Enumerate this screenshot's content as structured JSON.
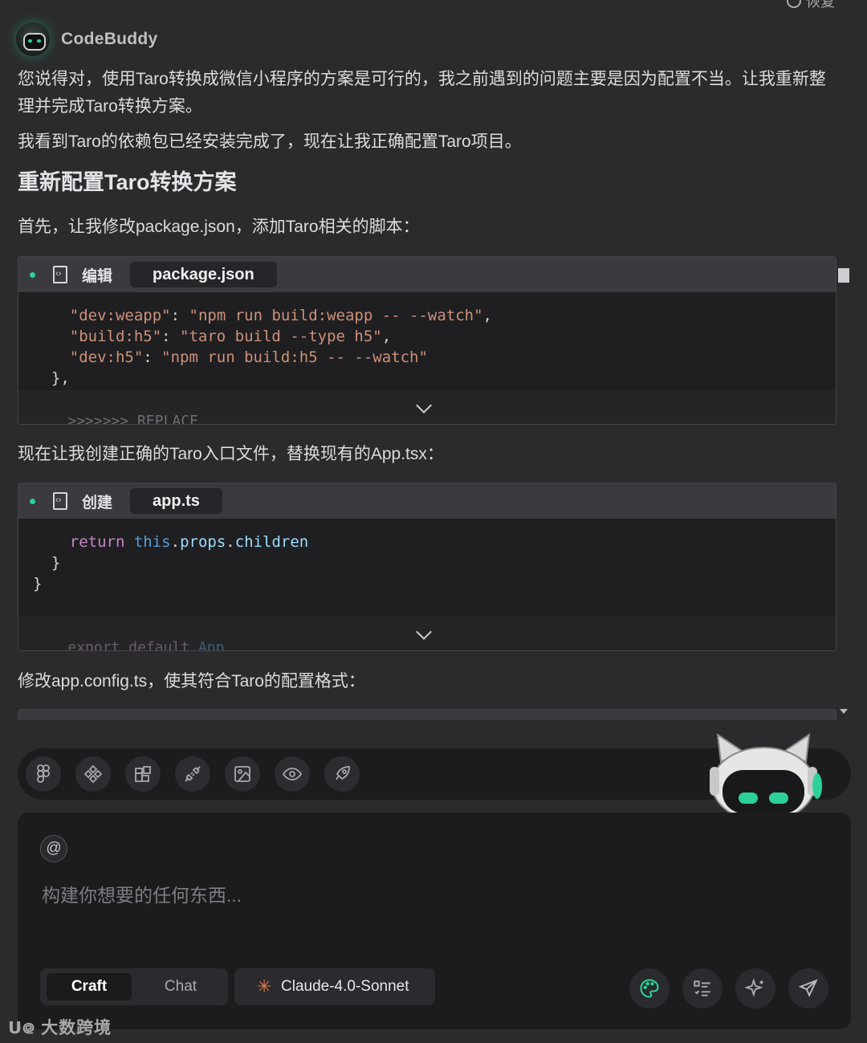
{
  "top_action": "恢复",
  "agent": {
    "name": "CodeBuddy"
  },
  "message": {
    "para1": "您说得对，使用Taro转换成微信小程序的方案是可行的，我之前遇到的问题主要是因为配置不当。让我重新整理并完成Taro转换方案。",
    "para2": "我看到Taro的依赖包已经安装完成了，现在让我正确配置Taro项目。",
    "heading": "重新配置Taro转换方案",
    "para3": "首先，让我修改package.json，添加Taro相关的脚本：",
    "para4": "现在让我创建正确的Taro入口文件，替换现有的App.tsx：",
    "para5": "修改app.config.ts，使其符合Taro的配置格式："
  },
  "cards": [
    {
      "action": "编辑",
      "file": "package.json",
      "lines": [
        {
          "key": "\"dev:weapp\"",
          "val": "\"npm run build:weapp -- --watch\"",
          "trail": ","
        },
        {
          "key": "\"build:h5\"",
          "val": "\"taro build --type h5\"",
          "trail": ","
        },
        {
          "key": "\"dev:h5\"",
          "val": "\"npm run build:h5 -- --watch\"",
          "trail": ""
        }
      ],
      "close": "},",
      "footer": ">>>>>>> REPLACE"
    },
    {
      "action": "创建",
      "file": "app.ts",
      "code_return": "return",
      "code_this": "this",
      "code_props": "props",
      "code_children": "children",
      "brace1": "}",
      "brace2": "}",
      "footer_export": "export",
      "footer_default": "default",
      "footer_app": "App"
    }
  ],
  "toolbar": {
    "icons": [
      "figma-icon",
      "components-icon",
      "blocks-icon",
      "plug-icon",
      "image-icon",
      "eye-icon",
      "rocket-icon"
    ]
  },
  "composer": {
    "at_symbol": "@",
    "placeholder": "构建你想要的任何东西...",
    "modes": [
      "Craft",
      "Chat"
    ],
    "active_mode": "Craft",
    "model": "Claude-4.0-Sonnet"
  },
  "watermark": "大数跨境",
  "colors": {
    "accent": "#2ed09a",
    "model_star": "#e07a4e"
  }
}
